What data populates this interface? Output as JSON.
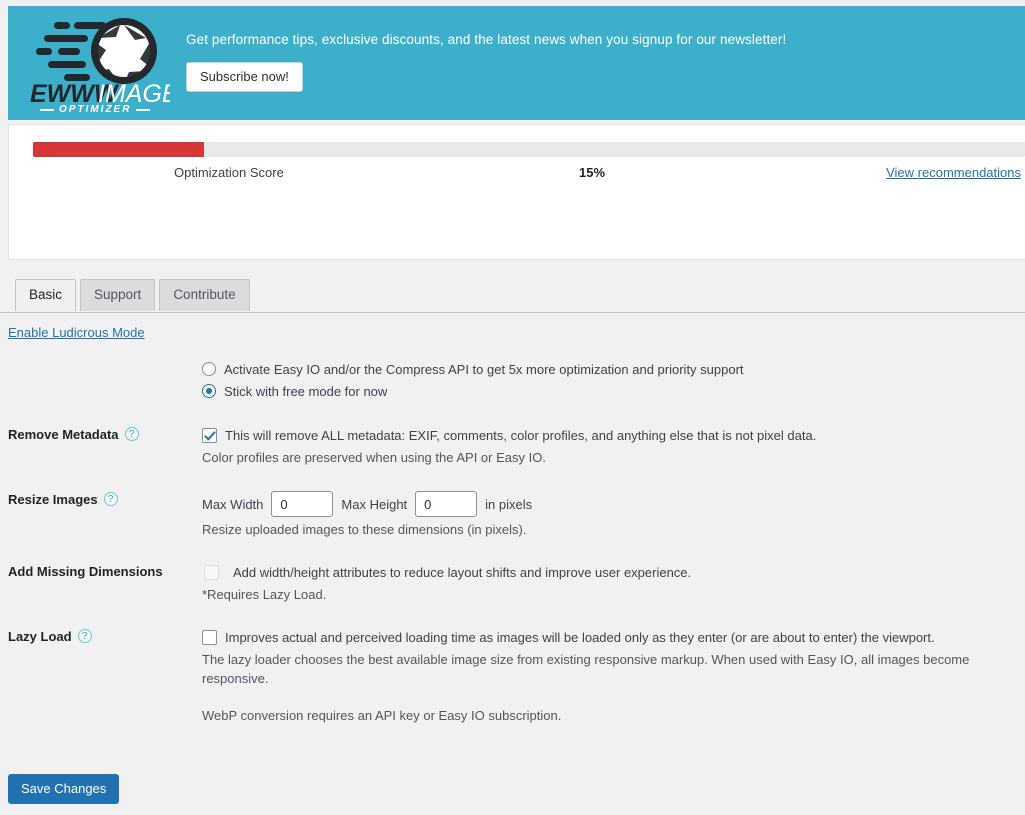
{
  "banner": {
    "logo_primary": "EWWW",
    "logo_secondary": "IMAGE",
    "logo_tagline": "OPTIMIZER",
    "message": "Get performance tips, exclusive discounts, and the latest news when you signup for our newsletter!",
    "subscribe_label": "Subscribe now!",
    "background_color": "#3cafcb"
  },
  "score": {
    "label": "Optimization Score",
    "value": "15%",
    "percent": 15,
    "link_label": "View recommendations",
    "bar_color": "#d63638",
    "track_color": "#e9e9e9"
  },
  "tabs": [
    {
      "label": "Basic",
      "active": true
    },
    {
      "label": "Support",
      "active": false
    },
    {
      "label": "Contribute",
      "active": false
    }
  ],
  "ludicrous_link": "Enable Ludicrous Mode",
  "settings": {
    "mode": {
      "options": [
        {
          "label": "Activate Easy IO and/or the Compress API to get 5x more optimization and priority support",
          "checked": false
        },
        {
          "label": "Stick with free mode for now",
          "checked": true
        }
      ]
    },
    "remove_metadata": {
      "title": "Remove Metadata",
      "help": "?",
      "checkbox_label": "This will remove ALL metadata: EXIF, comments, color profiles, and anything else that is not pixel data.",
      "checked": true,
      "description": "Color profiles are preserved when using the API or Easy IO."
    },
    "resize_images": {
      "title": "Resize Images",
      "help": "?",
      "max_width_label": "Max Width",
      "max_width_value": "0",
      "max_height_label": "Max Height",
      "max_height_value": "0",
      "units_label": "in pixels",
      "description": "Resize uploaded images to these dimensions (in pixels)."
    },
    "add_missing_dimensions": {
      "title": "Add Missing Dimensions",
      "checkbox_label": "Add width/height attributes to reduce layout shifts and improve user experience.",
      "checked": false,
      "disabled": true,
      "description": "*Requires Lazy Load."
    },
    "lazy_load": {
      "title": "Lazy Load",
      "help": "?",
      "checkbox_label": "Improves actual and perceived loading time as images will be loaded only as they enter (or are about to enter) the viewport.",
      "checked": false,
      "description": "The lazy loader chooses the best available image size from existing responsive markup. When used with Easy IO, all images become responsive."
    },
    "webp_note": "WebP conversion requires an API key or Easy IO subscription."
  },
  "save_label": "Save Changes"
}
